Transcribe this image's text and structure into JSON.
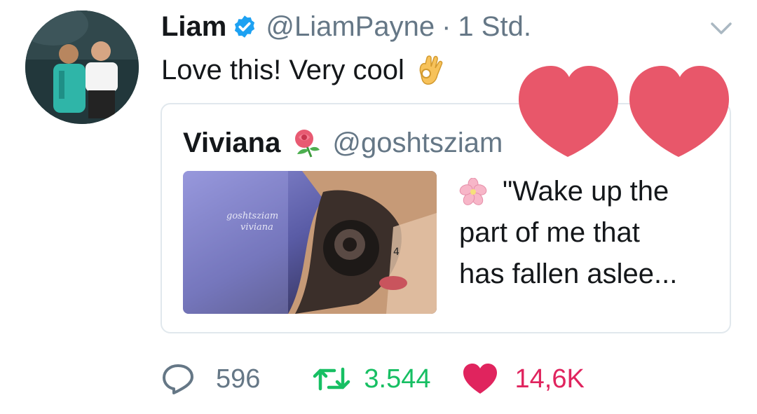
{
  "tweet": {
    "author_name": "Liam",
    "author_handle": "@LiamPayne",
    "separator": "·",
    "time": "1 Std.",
    "text": "Love this! Very cool"
  },
  "quoted": {
    "author_name": "Viviana",
    "author_handle": "@goshtsziam",
    "text_lines": [
      "\"Wake up the",
      "part of me that",
      "has fallen aslee..."
    ],
    "image_watermark_lines": [
      "goshtsziam",
      "viviana"
    ]
  },
  "actions": {
    "replies": "596",
    "retweets": "3.544",
    "likes": "14,6K"
  },
  "icons": {
    "verified": "verified-badge-icon",
    "menu": "chevron-down-icon",
    "reply": "reply-icon",
    "retweet": "retweet-icon",
    "like": "heart-icon"
  },
  "colors": {
    "verified": "#1da1f2",
    "secondary_text": "#657786",
    "retweet_green": "#17bf63",
    "like_red": "#e0245e",
    "sticker_heart": "#e8576a"
  }
}
